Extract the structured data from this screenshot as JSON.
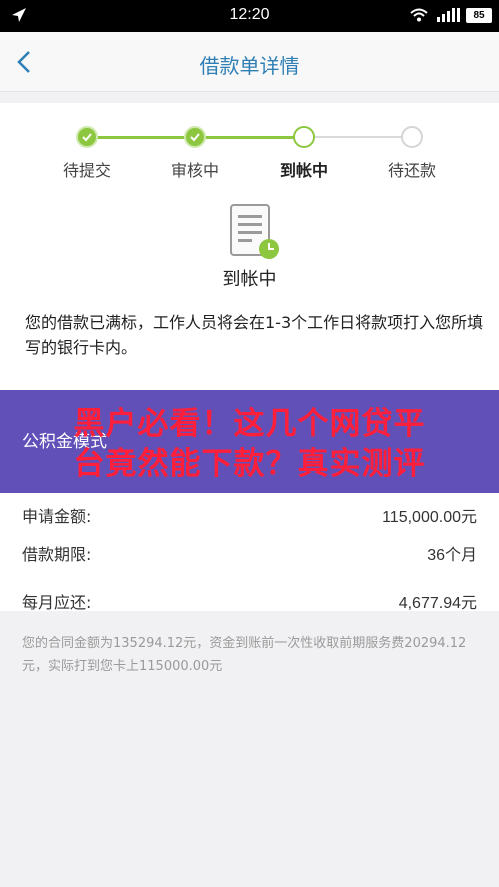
{
  "status_bar": {
    "time": "12:20",
    "battery": "85"
  },
  "nav": {
    "title": "借款单详情"
  },
  "steps": [
    {
      "label": "待提交",
      "state": "done"
    },
    {
      "label": "审核中",
      "state": "done"
    },
    {
      "label": "到帐中",
      "state": "current"
    },
    {
      "label": "待还款",
      "state": "todo"
    }
  ],
  "status": {
    "title": "到帐中"
  },
  "notice": "您的借款已满标，工作人员将会在1-3个工作日将款项打入您所填写的银行卡内。",
  "overlay": {
    "headline_line1": "黑户必看！这几个网贷平",
    "headline_line2": "台竟然能下款？真实测评",
    "fund_mode": "公积金模式"
  },
  "details": [
    {
      "label": "申请金额:",
      "value": "115,000.00元"
    },
    {
      "label": "借款期限:",
      "value": "36个月"
    },
    {
      "label": "每月应还:",
      "value": "4,677.94元"
    }
  ],
  "footnote": "您的合同金额为135294.12元，资金到账前一次性收取前期服务费20294.12元，实际打到您卡上115000.00元",
  "colors": {
    "accent_blue": "#2f7fb5",
    "progress_green": "#8dc63f",
    "overlay_purple": "#6050b8",
    "headline_red": "#ff1f3a"
  }
}
